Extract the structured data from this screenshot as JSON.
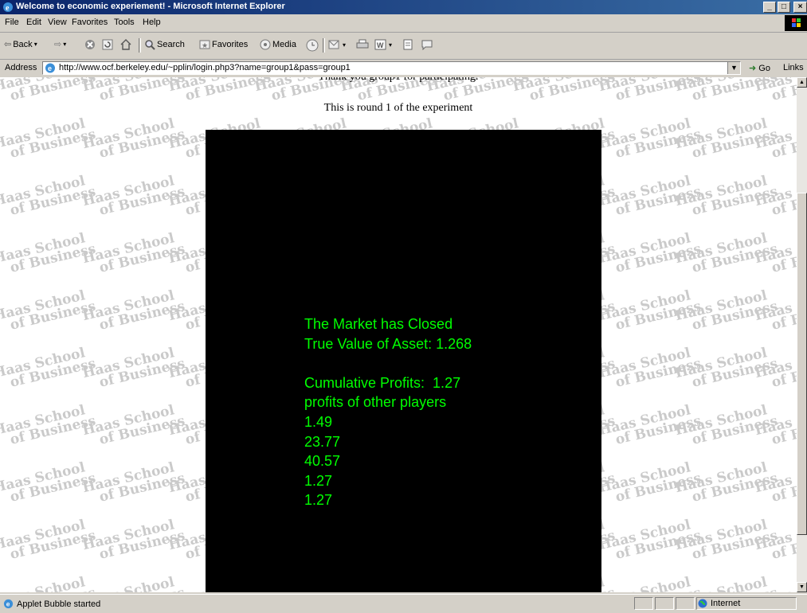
{
  "window": {
    "title": "Welcome to economic experiement! - Microsoft Internet Explorer",
    "controls": [
      "minimize",
      "maximize",
      "close"
    ]
  },
  "menubar": {
    "items": [
      "File",
      "Edit",
      "View",
      "Favorites",
      "Tools",
      "Help"
    ]
  },
  "toolbar": {
    "back_label": "Back",
    "search_label": "Search",
    "favorites_label": "Favorites",
    "media_label": "Media",
    "icons": [
      "back-icon",
      "forward-icon",
      "stop-icon",
      "refresh-icon",
      "home-icon",
      "search-icon",
      "favorites-icon",
      "media-icon",
      "history-icon",
      "mail-icon",
      "print-icon",
      "edit-icon",
      "discuss-icon",
      "messenger-icon"
    ]
  },
  "address": {
    "label": "Address",
    "url": "http://www.ocf.berkeley.edu/~pplin/login.php3?name=group1&pass=group1",
    "go_label": "Go",
    "links_label": "Links"
  },
  "page": {
    "thanks_text": "Thank you group1 for participating.",
    "round_text": "This is round 1 of the experiment",
    "watermark_line1": "Haas School",
    "watermark_line2": "of Business"
  },
  "applet": {
    "line1": "The Market has Closed",
    "line2": "True Value of Asset: 1.268",
    "line3": "",
    "line4": "Cumulative Profits:  1.27",
    "line5": "profits of other players",
    "other_profits": [
      "1.49",
      "23.77",
      "40.57",
      "1.27",
      "1.27"
    ],
    "text_color": "#00ff00",
    "background": "#000000"
  },
  "status": {
    "message": "Applet Bubble started",
    "zone": "Internet"
  },
  "colors": {
    "titlebar_start": "#0a246a",
    "titlebar_end": "#3a6ea5",
    "chrome": "#d4d0c8"
  }
}
